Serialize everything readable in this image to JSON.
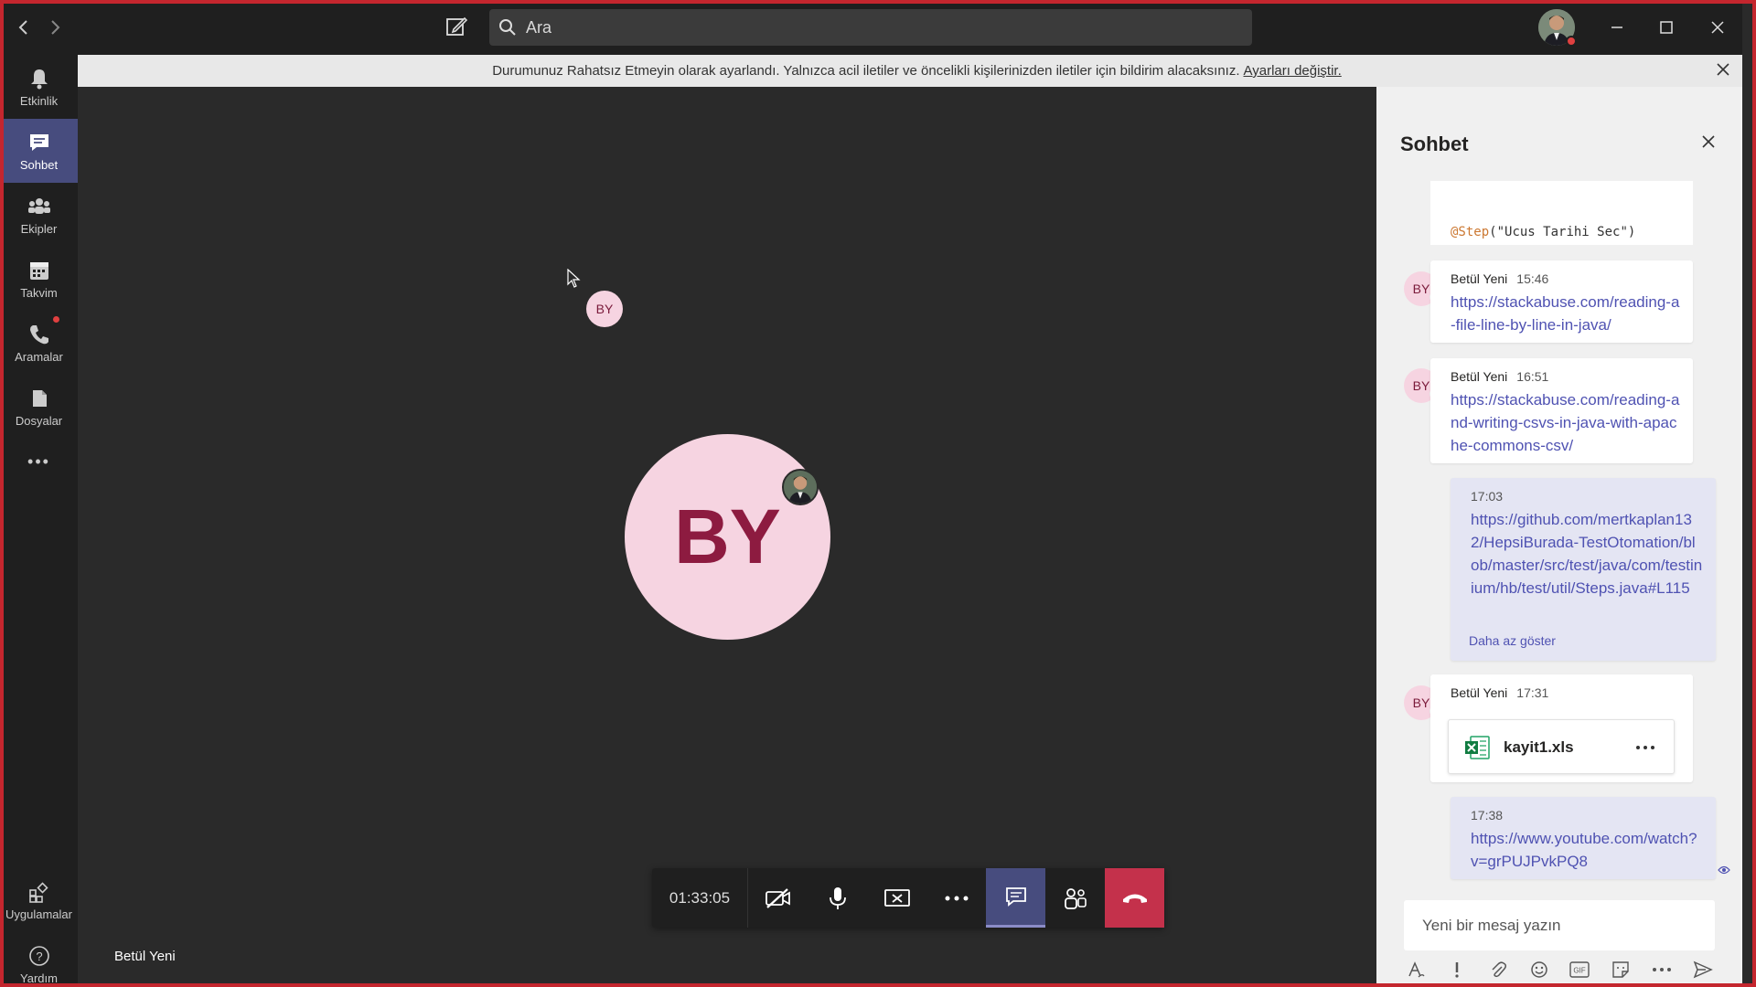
{
  "titlebar": {
    "search_placeholder": "Ara"
  },
  "rail": {
    "items": [
      {
        "label": "Etkinlik",
        "icon": "bell-icon"
      },
      {
        "label": "Sohbet",
        "icon": "chat-icon"
      },
      {
        "label": "Ekipler",
        "icon": "teams-icon"
      },
      {
        "label": "Takvim",
        "icon": "calendar-icon"
      },
      {
        "label": "Aramalar",
        "icon": "phone-icon"
      },
      {
        "label": "Dosyalar",
        "icon": "files-icon"
      }
    ],
    "more": "•••",
    "apps": "Uygulamalar",
    "help": "Yardım"
  },
  "notification": {
    "text": "Durumunuz Rahatsız Etmeyin olarak ayarlandı. Yalnızca acil iletiler ve öncelikli kişilerinizden iletiler için bildirim alacaksınız.",
    "link": "Ayarları değiştir."
  },
  "stage": {
    "small_avatar": "BY",
    "big_avatar": "BY",
    "participant_name": "Betül Yeni"
  },
  "controls": {
    "timer": "01:33:05"
  },
  "chat": {
    "title": "Sohbet",
    "code_snippet_annotation": "@Step",
    "code_snippet_rest": "(\"Ucus Tarihi Sec\")",
    "messages": [
      {
        "author": "Betül Yeni",
        "time": "15:46",
        "initials": "BY",
        "link": "https://stackabuse.com/reading-a-file-line-by-line-in-java/"
      },
      {
        "author": "Betül Yeni",
        "time": "16:51",
        "initials": "BY",
        "link": "https://stackabuse.com/reading-and-writing-csvs-in-java-with-apache-commons-csv/"
      },
      {
        "time": "17:03",
        "link": "https://github.com/mertkaplan132/HepsiBurada-TestOtomation/blob/master/src/test/java/com/testinium/hb/test/util/Steps.java#L115",
        "show_less": "Daha az göster"
      },
      {
        "author": "Betül Yeni",
        "time": "17:31",
        "initials": "BY",
        "file": "kayit1.xls"
      },
      {
        "time": "17:38",
        "link": "https://www.youtube.com/watch?v=grPUJPvkPQ8"
      }
    ],
    "compose_placeholder": "Yeni bir mesaj yazın"
  }
}
